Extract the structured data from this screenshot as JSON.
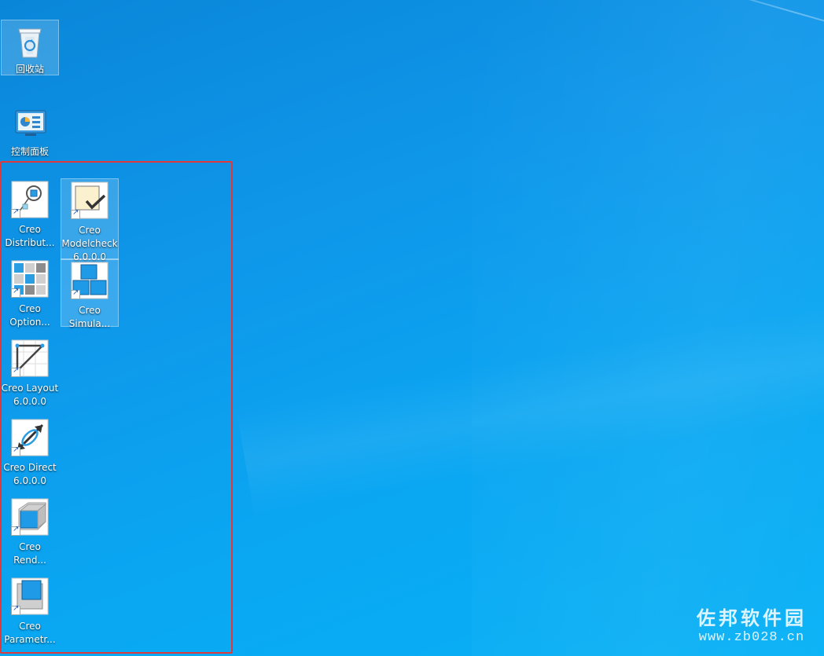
{
  "desktop": {
    "icons": [
      {
        "id": "recycle-bin",
        "label": "回收站",
        "icon": "recycle-bin-icon",
        "selected": true
      },
      {
        "id": "control-panel",
        "label": "控制面板",
        "icon": "control-panel-icon",
        "selected": false
      },
      {
        "id": "creo-distributed",
        "label": "Creo\nDistribut...",
        "icon": "creo-distributed-batch-icon",
        "selected": false
      },
      {
        "id": "creo-modelcheck",
        "label": "Creo\nModelcheck\n6.0.0.0",
        "icon": "creo-modelcheck-icon",
        "selected": true
      },
      {
        "id": "creo-options",
        "label": "Creo\nOption...",
        "icon": "creo-options-modeler-icon",
        "selected": false
      },
      {
        "id": "creo-simulate",
        "label": "Creo\nSimula...",
        "icon": "creo-simulate-icon",
        "selected": true
      },
      {
        "id": "creo-layout",
        "label": "Creo Layout\n6.0.0.0",
        "icon": "creo-layout-icon",
        "selected": false
      },
      {
        "id": "creo-direct",
        "label": "Creo Direct\n6.0.0.0",
        "icon": "creo-direct-icon",
        "selected": false
      },
      {
        "id": "creo-render",
        "label": "Creo\nRend...",
        "icon": "creo-render-studio-icon",
        "selected": false
      },
      {
        "id": "creo-parametric",
        "label": "Creo\nParametr...",
        "icon": "creo-parametric-icon",
        "selected": false
      }
    ]
  },
  "watermark": {
    "title": "佐邦软件园",
    "url": "www.zb028.cn"
  },
  "colors": {
    "desktop": "#0f97ea",
    "selection_outline": "#e0393d",
    "creo_blue": "#1a8fd6"
  }
}
